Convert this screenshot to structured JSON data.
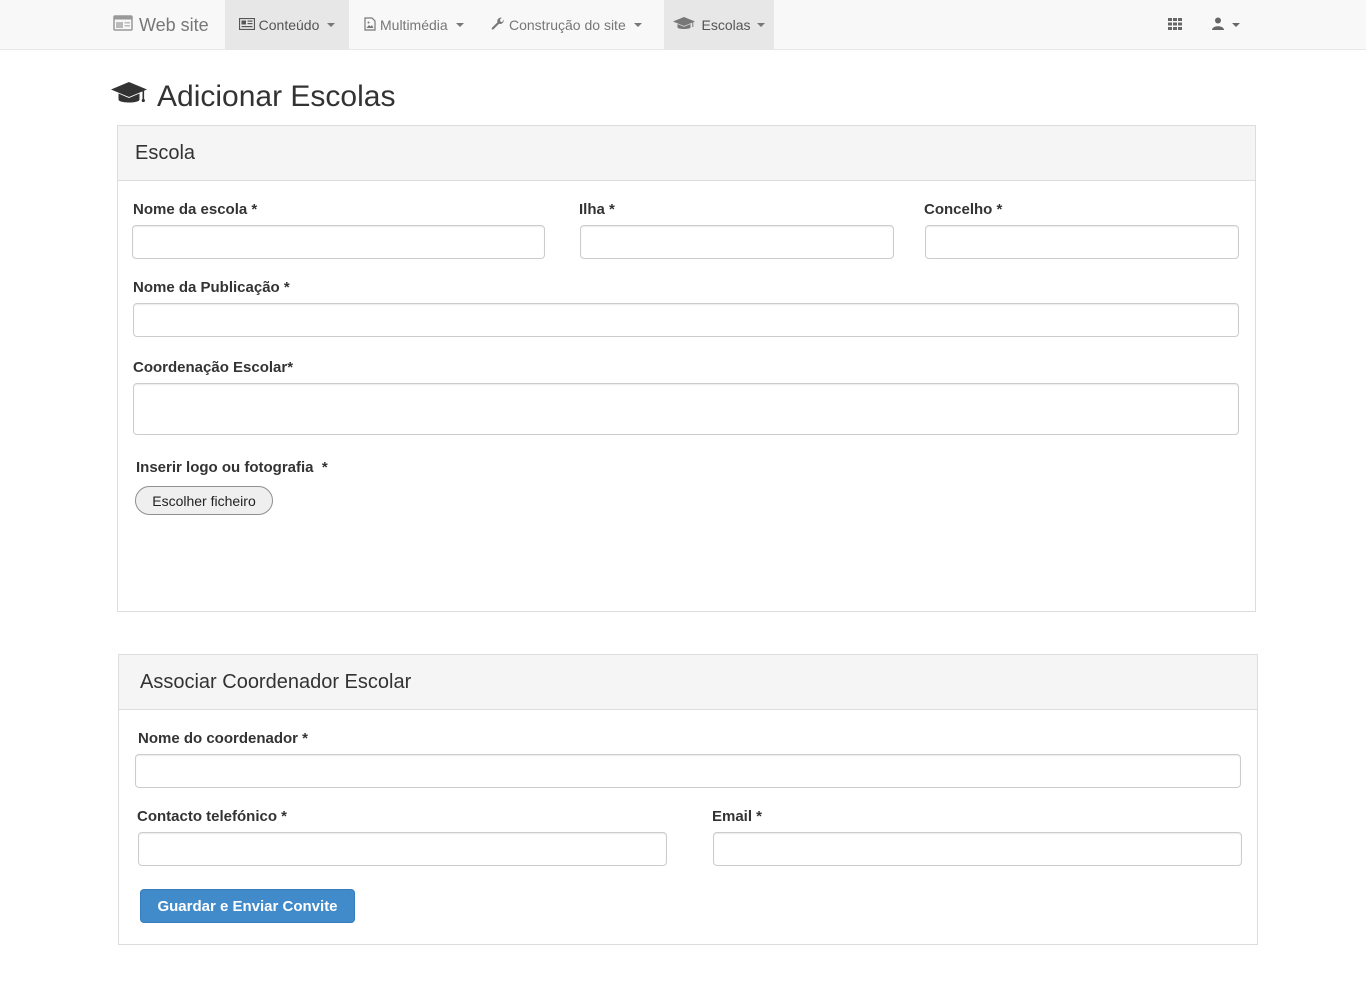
{
  "navbar": {
    "brand": "Web site",
    "items": [
      {
        "label": "Conteúdo",
        "icon": "newspaper-icon",
        "active": true
      },
      {
        "label": "Multimédia",
        "icon": "image-icon",
        "active": false
      },
      {
        "label": "Construção do site",
        "icon": "wrench-icon",
        "active": false
      },
      {
        "label": "Escolas",
        "icon": "graduation-cap-icon",
        "active": true
      }
    ],
    "right_icons": [
      "grid-icon",
      "user-icon"
    ]
  },
  "page": {
    "title": "Adicionar Escolas",
    "title_icon": "graduation-cap-icon"
  },
  "school_panel": {
    "heading": "Escola",
    "fields": {
      "school_name_label": "Nome da escola *",
      "island_label": "Ilha *",
      "municipality_label": "Concelho *",
      "publication_name_label": "Nome da Publicação *",
      "coordination_label": "Coordenação Escolar*",
      "logo_label": "Inserir logo ou fotografia  *",
      "file_button": "Escolher ficheiro"
    }
  },
  "coordinator_panel": {
    "heading": "Associar Coordenador Escolar",
    "fields": {
      "coordinator_name_label": "Nome do coordenador *",
      "phone_label": "Contacto telefónico *",
      "email_label": "Email *"
    },
    "submit_button": "Guardar e Enviar Convite"
  },
  "colors": {
    "primary": "#428bca",
    "navbar_bg": "#f8f8f8",
    "panel_heading_bg": "#f5f5f5"
  }
}
